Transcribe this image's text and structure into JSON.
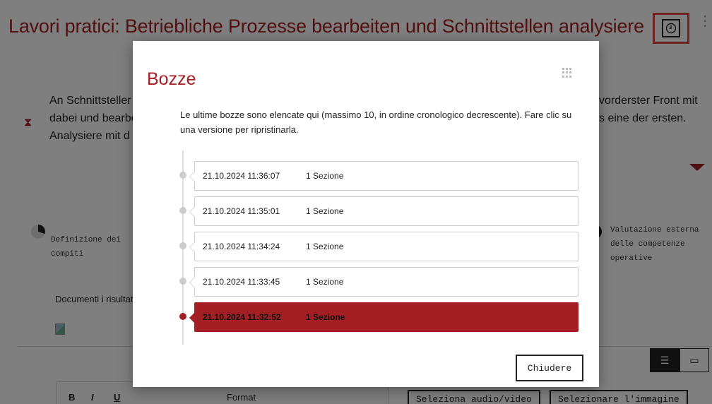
{
  "page": {
    "title": "Lavori pratici: Betriebliche Prozesse bearbeiten und Schnittstellen analysiere",
    "intro_lines": [
      "An Schnittsteller",
      "dabei und bearbe",
      "Analysiere mit d"
    ],
    "intro_right": [
      "vorderster Front mit",
      "s eine der ersten."
    ],
    "task_definition": "Definizione dei compiti",
    "evaluation": "Valutazione esterna delle competenze operative",
    "documents_label": "Documenti i risultat",
    "toolbar": [
      "B",
      "I",
      "U",
      "Format"
    ],
    "media_buttons": [
      "Seleziona audio/video",
      "Selezionare l'immagine"
    ],
    "icons": {
      "history": "history-clock-icon",
      "hourglass": "hourglass-icon",
      "more": "more-vertical-icon",
      "grid": "grid-dots-icon",
      "view_split": "split-view-icon",
      "view_preview": "preview-icon"
    },
    "accent_color": "#a41f23"
  },
  "modal": {
    "title": "Bozze",
    "description": "Le ultime bozze sono elencate qui (massimo 10, in ordine cronologico decrescente). Fare clic su una versione per ripristinarla.",
    "drafts": [
      {
        "date": "21.10.2024 11:36:07",
        "sections": "1 Sezione",
        "active": false
      },
      {
        "date": "21.10.2024 11:35:01",
        "sections": "1 Sezione",
        "active": false
      },
      {
        "date": "21.10.2024 11:34:24",
        "sections": "1 Sezione",
        "active": false
      },
      {
        "date": "21.10.2024 11:33:45",
        "sections": "1 Sezione",
        "active": false
      },
      {
        "date": "21.10.2024 11:32:52",
        "sections": "1 Sezione",
        "active": true
      }
    ],
    "close_label": "Chiudere"
  }
}
